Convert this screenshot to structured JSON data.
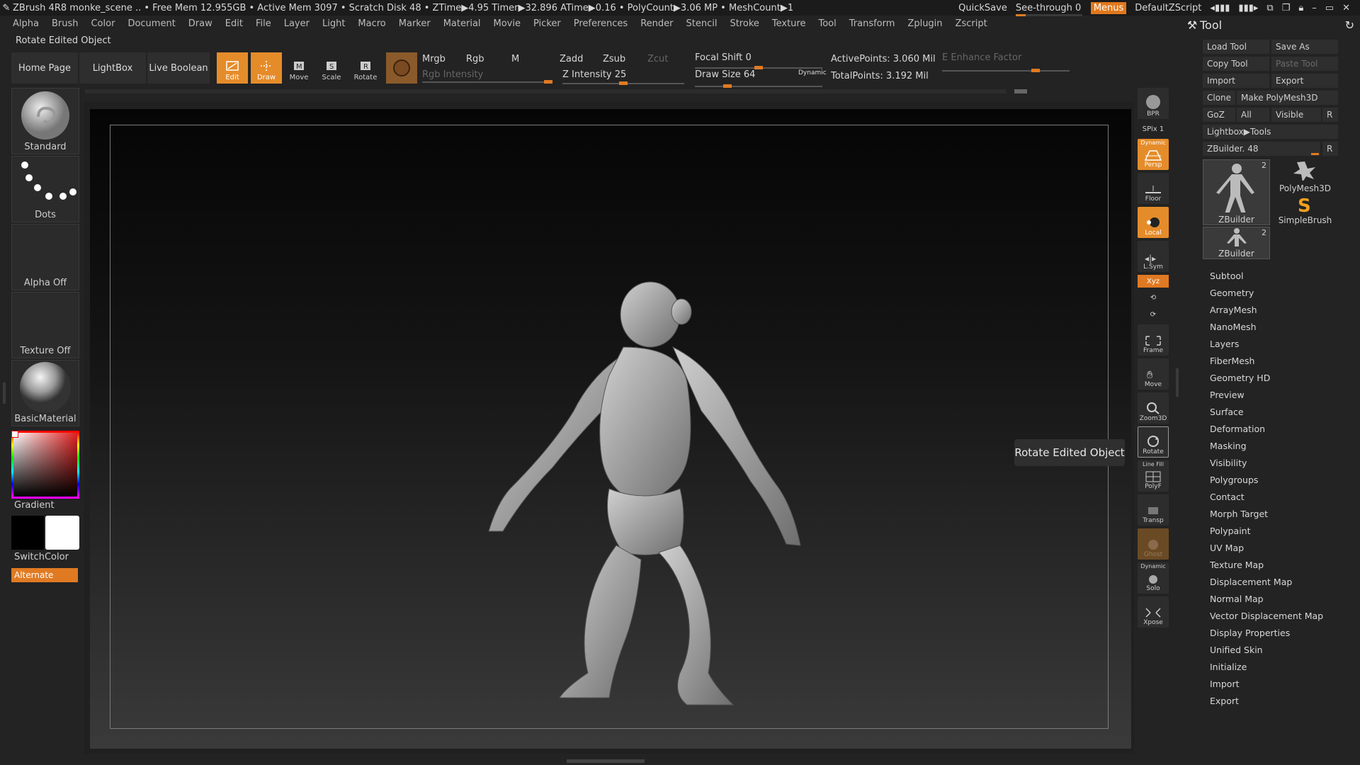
{
  "titlebar": {
    "text": "ZBrush 4R8    monke_scene  .. • Free Mem 12.955GB • Active Mem 3097 • Scratch Disk 48 •  ZTime▶4.95 Timer▶32.896 ATime▶0.16 • PolyCount▶3.06 MP  • MeshCount▶1",
    "quicksave": "QuickSave",
    "seethrough": "See-through  0",
    "menus": "Menus",
    "script": "DefaultZScript"
  },
  "menubar": [
    "Alpha",
    "Brush",
    "Color",
    "Document",
    "Draw",
    "Edit",
    "File",
    "Layer",
    "Light",
    "Macro",
    "Marker",
    "Material",
    "Movie",
    "Picker",
    "Preferences",
    "Render",
    "Stencil",
    "Stroke",
    "Texture",
    "Tool",
    "Transform",
    "Zplugin",
    "Zscript"
  ],
  "status_text": "Rotate Edited Object",
  "shelf": {
    "home": "Home Page",
    "lightbox": "LightBox",
    "live_boolean": "Live Boolean",
    "edit": "Edit",
    "draw": "Draw",
    "move": "Move",
    "scale": "Scale",
    "rotate": "Rotate",
    "mrgb": "Mrgb",
    "rgb": "Rgb",
    "m": "M",
    "rgb_intensity": "Rgb Intensity",
    "zadd": "Zadd",
    "zsub": "Zsub",
    "zcut": "Zcut",
    "z_intensity": "Z Intensity 25",
    "focal_shift": "Focal Shift 0",
    "draw_size": "Draw Size 64",
    "dynamic": "Dynamic",
    "active_points": "ActivePoints: 3.060 Mil",
    "total_points": "TotalPoints: 3.192 Mil",
    "enhance": "E Enhance Factor"
  },
  "left_panel": {
    "brush": "Standard",
    "stroke": "Dots",
    "alpha": "Alpha Off",
    "texture": "Texture Off",
    "material": "BasicMaterial",
    "gradient": "Gradient",
    "switchcolor": "SwitchColor",
    "alternate": "Alternate"
  },
  "right_shelf": {
    "bpr": "BPR",
    "spix": "SPix 1",
    "dynamic": "Dynamic",
    "persp": "Persp",
    "floor": "Floor",
    "local": "Local",
    "lsym": "L.Sym",
    "xyz": "Xyz",
    "frame": "Frame",
    "move": "Move",
    "zoom3d": "Zoom3D",
    "rotate": "Rotate",
    "linefill": "Line Fill",
    "polyf": "PolyF",
    "transp": "Transp",
    "ghost": "Ghost",
    "dynamic2": "Dynamic",
    "solo": "Solo",
    "xpose": "Xpose"
  },
  "tooltip": "Rotate Edited Object",
  "tool_panel": {
    "title": "Tool",
    "load_tool": "Load Tool",
    "save_as": "Save As",
    "copy_tool": "Copy Tool",
    "paste_tool": "Paste Tool",
    "import": "Import",
    "export": "Export",
    "clone": "Clone",
    "make_polymesh": "Make PolyMesh3D",
    "goz": "GoZ",
    "all": "All",
    "visible": "Visible",
    "r": "R",
    "lightbox_tools": "Lightbox▶Tools",
    "zbuilder_slider": "ZBuilder. 48",
    "thumb1": "ZBuilder",
    "thumb1_num": "2",
    "thumb2": "PolyMesh3D",
    "thumb3": "SimpleBrush",
    "thumb4": "ZBuilder",
    "thumb4_num": "2",
    "sections": [
      "Subtool",
      "Geometry",
      "ArrayMesh",
      "NanoMesh",
      "Layers",
      "FiberMesh",
      "Geometry HD",
      "Preview",
      "Surface",
      "Deformation",
      "Masking",
      "Visibility",
      "Polygroups",
      "Contact",
      "Morph Target",
      "Polypaint",
      "UV Map",
      "Texture Map",
      "Displacement Map",
      "Normal Map",
      "Vector Displacement Map",
      "Display Properties",
      "Unified Skin",
      "Initialize",
      "Import",
      "Export"
    ]
  }
}
